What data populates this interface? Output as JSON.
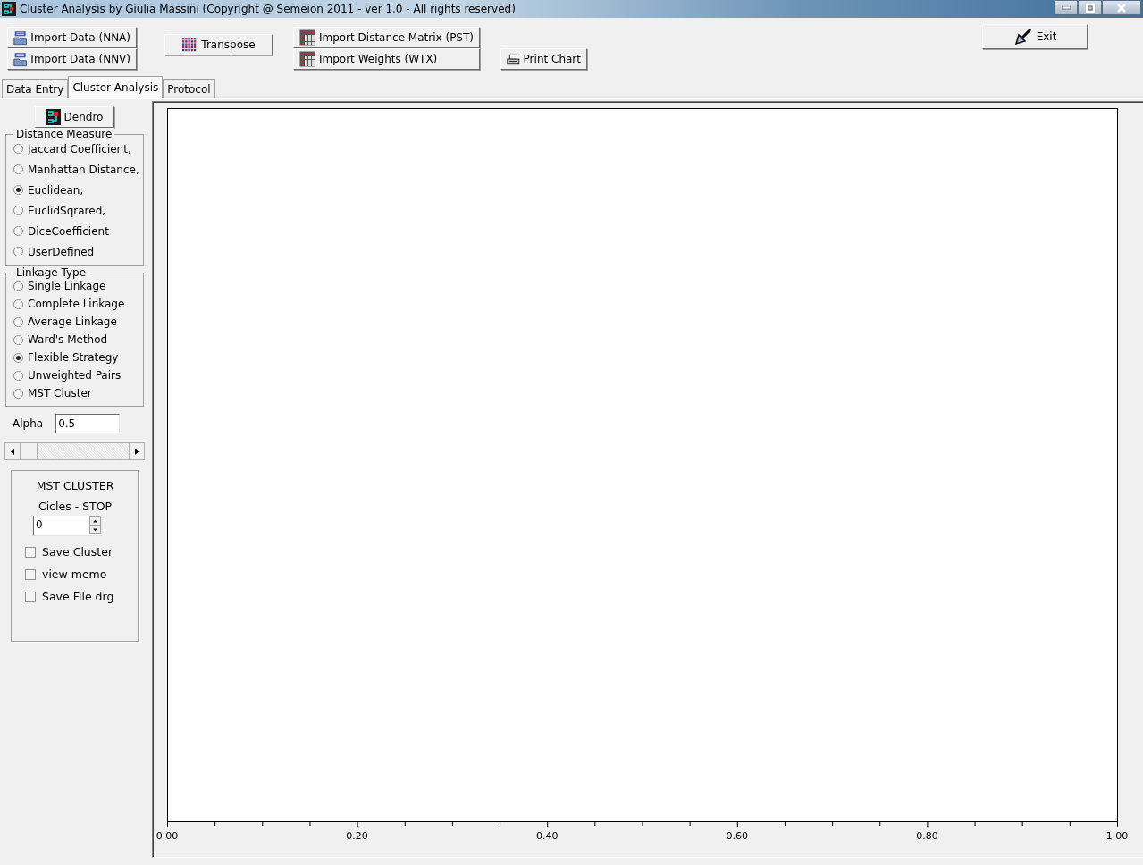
{
  "window": {
    "title": "Cluster Analysis by Giulia Massini (Copyright @ Semeion 2011 - ver 1.0 - All rights reserved)"
  },
  "toolbar": {
    "import_data": [
      "Import Data (NNA)",
      "Import Data (NNV)"
    ],
    "transpose": "Transpose",
    "import_matrix": [
      "Import  Distance  Matrix (PST)",
      "Import Weights (WTX)"
    ],
    "print_chart": "Print Chart",
    "exit": "Exit"
  },
  "tabs": [
    {
      "label": "Data Entry",
      "selected": false
    },
    {
      "label": "Cluster Analysis",
      "selected": true
    },
    {
      "label": "Protocol",
      "selected": false
    }
  ],
  "dendro_button": "Dendro",
  "distance_measure": {
    "title": "Distance Measure",
    "options": [
      {
        "label": "Jaccard Coefficient,",
        "selected": false
      },
      {
        "label": "Manhattan Distance,",
        "selected": false
      },
      {
        "label": "Euclidean,",
        "selected": true
      },
      {
        "label": "EuclidSqrared,",
        "selected": false
      },
      {
        "label": "DiceCoefficient",
        "selected": false
      },
      {
        "label": "UserDefined",
        "selected": false
      }
    ]
  },
  "linkage_type": {
    "title": "Linkage Type",
    "options": [
      {
        "label": "Single Linkage",
        "selected": false
      },
      {
        "label": "Complete Linkage",
        "selected": false
      },
      {
        "label": "Average Linkage",
        "selected": false
      },
      {
        "label": "Ward's Method",
        "selected": false
      },
      {
        "label": "Flexible Strategy",
        "selected": true
      },
      {
        "label": "Unweighted Pairs",
        "selected": false
      },
      {
        "label": "MST Cluster",
        "selected": false
      }
    ]
  },
  "alpha": {
    "label": "Alpha",
    "value": "0.5"
  },
  "mst_cluster": {
    "title": "MST CLUSTER",
    "cycles_label": "Cicles -  STOP",
    "cycles_value": "0",
    "checkboxes": [
      {
        "label": "Save Cluster",
        "checked": false
      },
      {
        "label": "view memo",
        "checked": false
      },
      {
        "label": "Save File drg",
        "checked": false
      }
    ]
  },
  "chart": {
    "axis_labels": [
      "0.00",
      "0.20",
      "0.40",
      "0.60",
      "0.80",
      "1.00"
    ]
  }
}
